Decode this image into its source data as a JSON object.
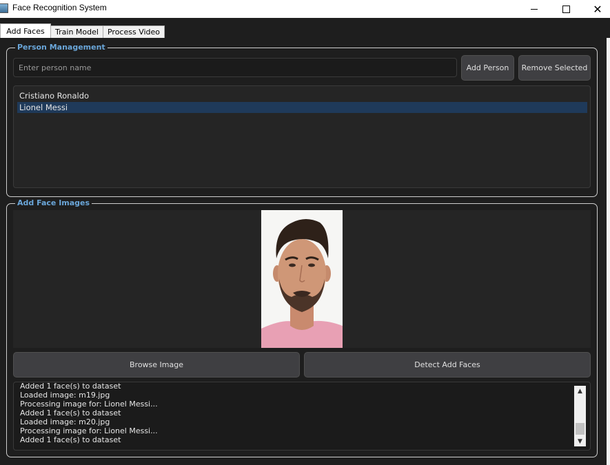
{
  "window": {
    "title": "Face Recognition System",
    "controls": {
      "minimize": "minimize-icon",
      "maximize": "maximize-icon",
      "close": "close-icon"
    }
  },
  "tabs": [
    {
      "label": "Add Faces",
      "active": true
    },
    {
      "label": "Train Model",
      "active": false
    },
    {
      "label": "Process Video",
      "active": false
    }
  ],
  "person_management": {
    "title": "Person Management",
    "name_input": {
      "placeholder": "Enter person name",
      "value": ""
    },
    "add_button": "Add Person",
    "remove_button": "Remove Selected",
    "persons": [
      {
        "name": "Cristiano Ronaldo",
        "selected": false
      },
      {
        "name": "Lionel Messi",
        "selected": true
      }
    ]
  },
  "add_face_images": {
    "title": "Add Face Images",
    "browse_button": "Browse Image",
    "detect_button": "Detect  Add Faces",
    "log": [
      "Added 1 face(s) to dataset",
      "Loaded image: m19.jpg",
      "Processing image for: Lionel Messi...",
      "Added 1 face(s) to dataset",
      "Loaded image: m20.jpg",
      "Processing image for: Lionel Messi...",
      "Added 1 face(s) to dataset"
    ]
  },
  "colors": {
    "background": "#1e1e1e",
    "group_title": "#6aa6d9",
    "button": "#3f3f42",
    "selection": "#1f3a5a"
  }
}
